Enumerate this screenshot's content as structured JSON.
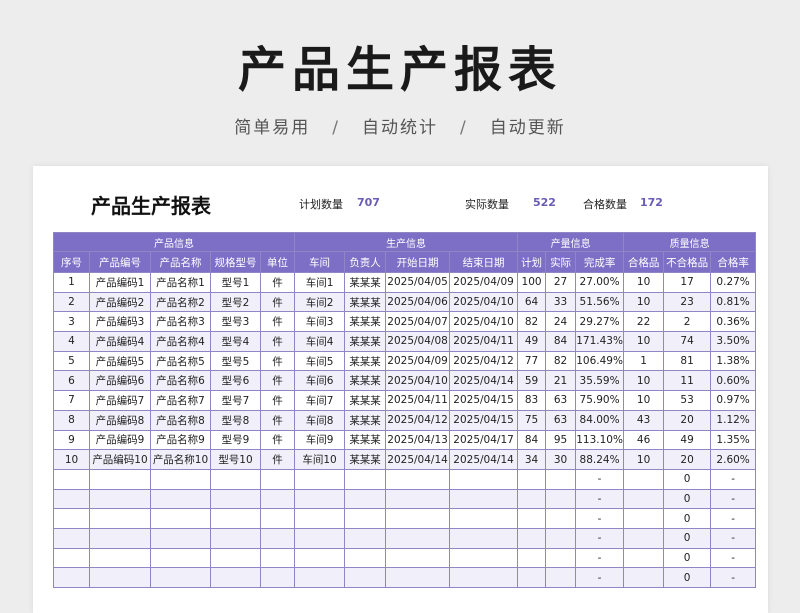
{
  "header": {
    "title": "产品生产报表",
    "tags": [
      "简单易用",
      "自动统计",
      "自动更新"
    ],
    "separator": "/"
  },
  "sheet": {
    "title": "产品生产报表",
    "stats": [
      {
        "label": "计划数量",
        "value": "707"
      },
      {
        "label": "实际数量",
        "value": "522"
      },
      {
        "label": "合格数量",
        "value": "172"
      }
    ]
  },
  "table": {
    "groups": [
      "产品信息",
      "生产信息",
      "产量信息",
      "质量信息"
    ],
    "columns": [
      "序号",
      "产品编号",
      "产品名称",
      "规格型号",
      "单位",
      "车间",
      "负责人",
      "开始日期",
      "结束日期",
      "计划",
      "实际",
      "完成率",
      "合格品",
      "不合格品",
      "合格率"
    ],
    "rows": [
      [
        "1",
        "产品编码1",
        "产品名称1",
        "型号1",
        "件",
        "车间1",
        "某某某",
        "2025/04/05",
        "2025/04/09",
        "100",
        "27",
        "27.00%",
        "10",
        "17",
        "0.27%"
      ],
      [
        "2",
        "产品编码2",
        "产品名称2",
        "型号2",
        "件",
        "车间2",
        "某某某",
        "2025/04/06",
        "2025/04/10",
        "64",
        "33",
        "51.56%",
        "10",
        "23",
        "0.81%"
      ],
      [
        "3",
        "产品编码3",
        "产品名称3",
        "型号3",
        "件",
        "车间3",
        "某某某",
        "2025/04/07",
        "2025/04/10",
        "82",
        "24",
        "29.27%",
        "22",
        "2",
        "0.36%"
      ],
      [
        "4",
        "产品编码4",
        "产品名称4",
        "型号4",
        "件",
        "车间4",
        "某某某",
        "2025/04/08",
        "2025/04/11",
        "49",
        "84",
        "171.43%",
        "10",
        "74",
        "3.50%"
      ],
      [
        "5",
        "产品编码5",
        "产品名称5",
        "型号5",
        "件",
        "车间5",
        "某某某",
        "2025/04/09",
        "2025/04/12",
        "77",
        "82",
        "106.49%",
        "1",
        "81",
        "1.38%"
      ],
      [
        "6",
        "产品编码6",
        "产品名称6",
        "型号6",
        "件",
        "车间6",
        "某某某",
        "2025/04/10",
        "2025/04/14",
        "59",
        "21",
        "35.59%",
        "10",
        "11",
        "0.60%"
      ],
      [
        "7",
        "产品编码7",
        "产品名称7",
        "型号7",
        "件",
        "车间7",
        "某某某",
        "2025/04/11",
        "2025/04/15",
        "83",
        "63",
        "75.90%",
        "10",
        "53",
        "0.97%"
      ],
      [
        "8",
        "产品编码8",
        "产品名称8",
        "型号8",
        "件",
        "车间8",
        "某某某",
        "2025/04/12",
        "2025/04/15",
        "75",
        "63",
        "84.00%",
        "43",
        "20",
        "1.12%"
      ],
      [
        "9",
        "产品编码9",
        "产品名称9",
        "型号9",
        "件",
        "车间9",
        "某某某",
        "2025/04/13",
        "2025/04/17",
        "84",
        "95",
        "113.10%",
        "46",
        "49",
        "1.35%"
      ],
      [
        "10",
        "产品编码10",
        "产品名称10",
        "型号10",
        "件",
        "车间10",
        "某某某",
        "2025/04/14",
        "2025/04/14",
        "34",
        "30",
        "88.24%",
        "10",
        "20",
        "2.60%"
      ],
      [
        "",
        "",
        "",
        "",
        "",
        "",
        "",
        "",
        "",
        "",
        "",
        "-",
        "",
        "0",
        "-"
      ],
      [
        "",
        "",
        "",
        "",
        "",
        "",
        "",
        "",
        "",
        "",
        "",
        "-",
        "",
        "0",
        "-"
      ],
      [
        "",
        "",
        "",
        "",
        "",
        "",
        "",
        "",
        "",
        "",
        "",
        "-",
        "",
        "0",
        "-"
      ],
      [
        "",
        "",
        "",
        "",
        "",
        "",
        "",
        "",
        "",
        "",
        "",
        "-",
        "",
        "0",
        "-"
      ],
      [
        "",
        "",
        "",
        "",
        "",
        "",
        "",
        "",
        "",
        "",
        "",
        "-",
        "",
        "0",
        "-"
      ],
      [
        "",
        "",
        "",
        "",
        "",
        "",
        "",
        "",
        "",
        "",
        "",
        "-",
        "",
        "0",
        "-"
      ]
    ]
  }
}
